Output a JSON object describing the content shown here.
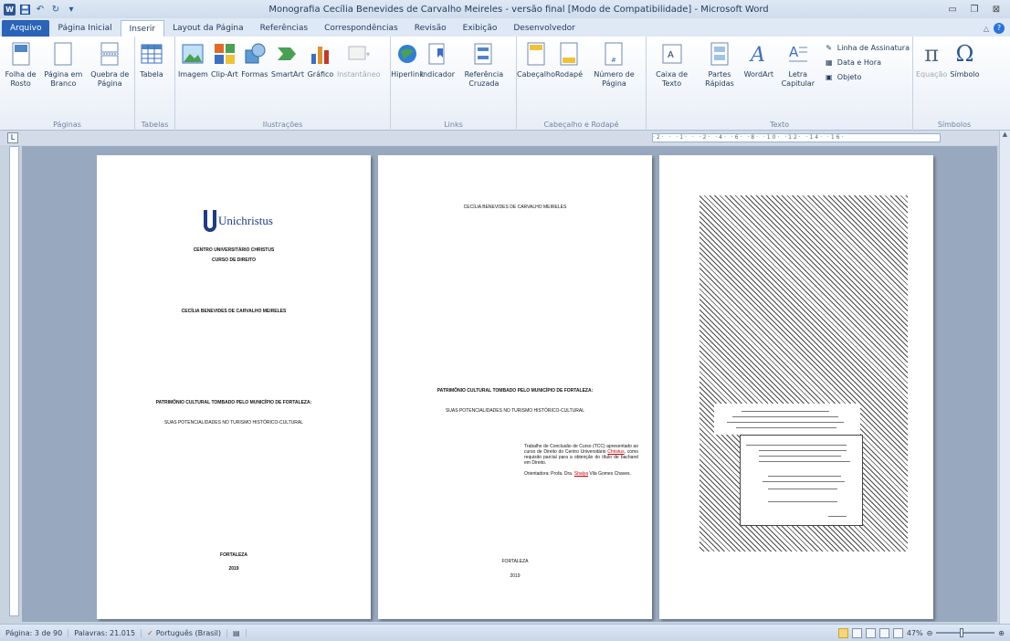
{
  "window": {
    "title": "Monografia Cecília Benevides de Carvalho Meireles - versão final [Modo de Compatibilidade] - Microsoft Word"
  },
  "tabs": [
    {
      "label": "Arquivo"
    },
    {
      "label": "Página Inicial"
    },
    {
      "label": "Inserir"
    },
    {
      "label": "Layout da Página"
    },
    {
      "label": "Referências"
    },
    {
      "label": "Correspondências"
    },
    {
      "label": "Revisão"
    },
    {
      "label": "Exibição"
    },
    {
      "label": "Desenvolvedor"
    }
  ],
  "ribbon": {
    "paginas": {
      "label": "Páginas",
      "buttons": [
        "Folha de Rosto",
        "Página em Branco",
        "Quebra de Página"
      ]
    },
    "tabelas": {
      "label": "Tabelas",
      "buttons": [
        "Tabela"
      ]
    },
    "ilustracoes": {
      "label": "Ilustrações",
      "buttons": [
        "Imagem",
        "Clip-Art",
        "Formas",
        "SmartArt",
        "Gráfico",
        "Instantâneo"
      ]
    },
    "links": {
      "label": "Links",
      "buttons": [
        "Hiperlink",
        "Indicador",
        "Referência Cruzada"
      ]
    },
    "cabecalho": {
      "label": "Cabeçalho e Rodapé",
      "buttons": [
        "Cabeçalho",
        "Rodapé",
        "Número de Página"
      ]
    },
    "texto": {
      "label": "Texto",
      "buttons": [
        "Caixa de Texto",
        "Partes Rápidas",
        "WordArt",
        "Letra Capitular"
      ],
      "small": [
        "Linha de Assinatura",
        "Data e Hora",
        "Objeto"
      ]
    },
    "simbolos": {
      "label": "Símbolos",
      "buttons": [
        "Equação",
        "Símbolo"
      ]
    }
  },
  "ruler": {
    "marks": "·2· · ·1· · ·2· ·4· ·6· ·8· ·10· ·12· ·14· ·16·"
  },
  "pages": {
    "p1": {
      "logo": "Unichristus",
      "institution": "CENTRO UNIVERSITÁRIO CHRISTUS",
      "course": "CURSO DE DIREITO",
      "author": "CECÍLIA BENEVIDES DE CARVALHO MEIRELES",
      "title": "PATRIMÔNIO CULTURAL TOMBADO PELO MUNICÍPIO DE FORTALEZA:",
      "subtitle": "SUAS POTENCIALIDADES NO TURISMO HISTÓRICO-CULTURAL",
      "city": "FORTALEZA",
      "year": "2019"
    },
    "p2": {
      "author": "CECÍLIA BENEVIDES DE CARVALHO MEIRELES",
      "title": "PATRIMÔNIO CULTURAL TOMBADO PELO MUNICÍPIO DE FORTALEZA:",
      "subtitle": "SUAS POTENCIALIDADES NO TURISMO HISTÓRICO-CULTURAL",
      "abstract_a": "Trabalho de Conclusão de Curso (TCC) apresentado ao curso de Direito do Centro Universitário ",
      "abstract_red": "Christus",
      "abstract_b": ", como requisito parcial para a obtenção do título de bacharel em Direito.",
      "advisor_a": "Orientadora: Profa. Dra. ",
      "advisor_red": "Shalya",
      "advisor_b": " Vila Gomes Chaves.",
      "city": "FORTALEZA",
      "year": "2019"
    }
  },
  "statusbar": {
    "page": "Página: 3 de 90",
    "words": "Palavras: 21.015",
    "language": "Português (Brasil)",
    "zoom": "47%"
  }
}
